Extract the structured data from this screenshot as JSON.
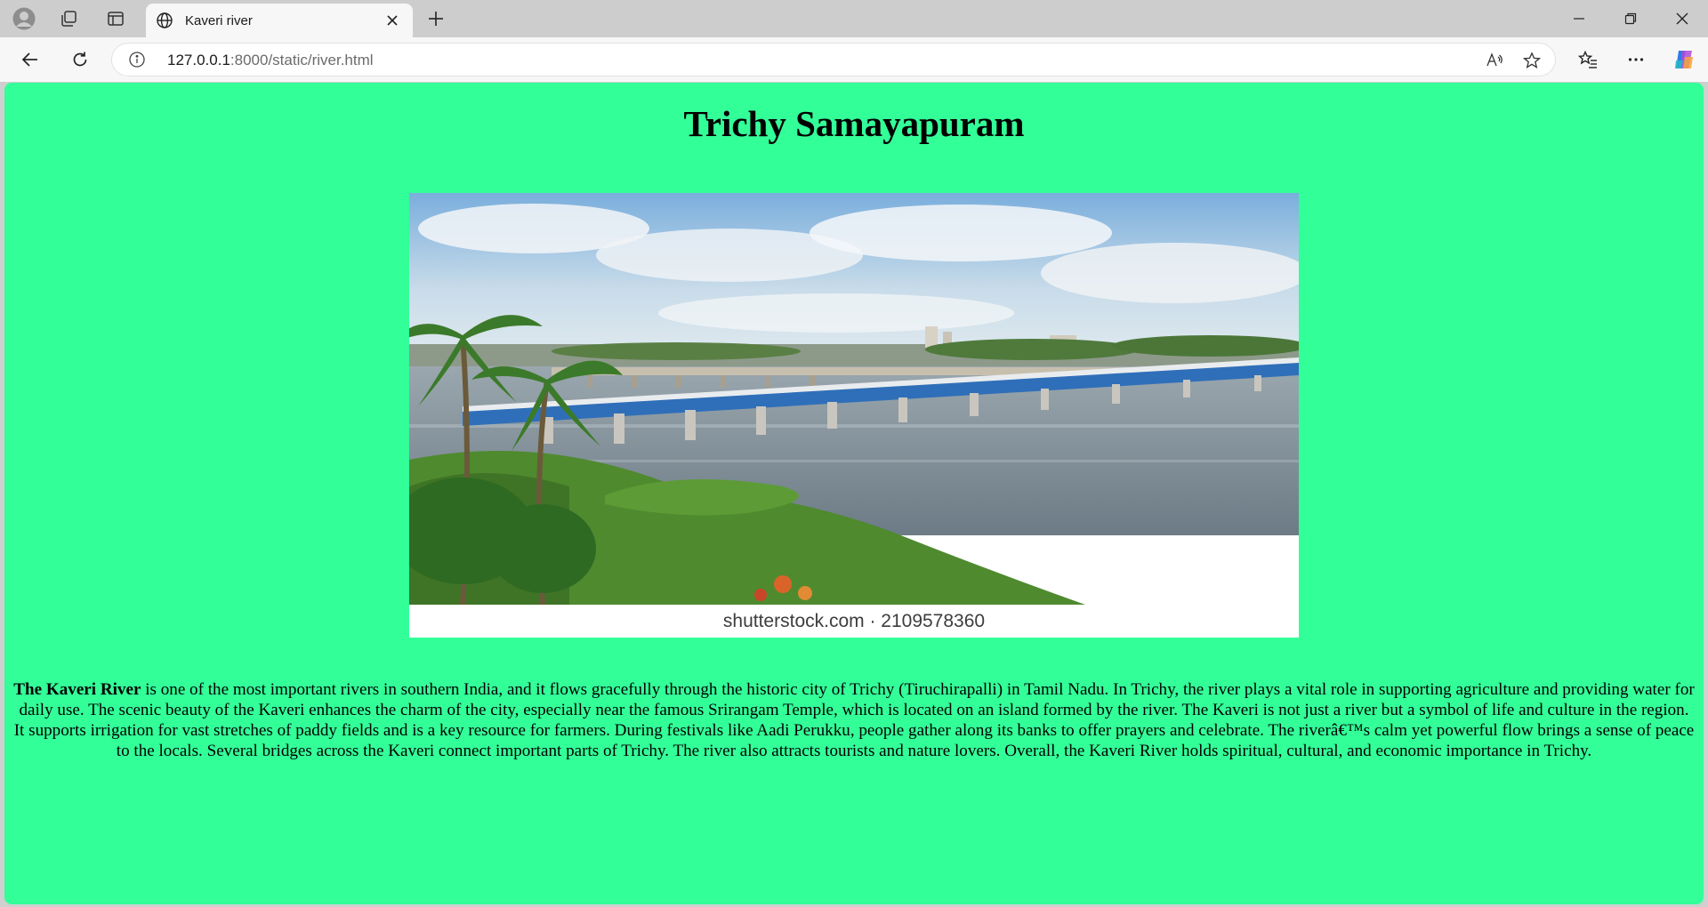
{
  "browser": {
    "tab": {
      "title": "Kaveri river"
    },
    "address": {
      "host": "127.0.0.1",
      "path": ":8000/static/river.html"
    }
  },
  "page": {
    "heading": "Trichy Samayapuram",
    "image": {
      "watermark": "shutterstock.com · 2109578360"
    },
    "paragraph": {
      "bold_lead": "The Kaveri River",
      "body": " is one of the most important rivers in southern India, and it flows gracefully through the historic city of Trichy (Tiruchirapalli) in Tamil Nadu. In Trichy, the river plays a vital role in supporting agriculture and providing water for daily use. The scenic beauty of the Kaveri enhances the charm of the city, especially near the famous Srirangam Temple, which is located on an island formed by the river. The Kaveri is not just a river but a symbol of life and culture in the region. It supports irrigation for vast stretches of paddy fields and is a key resource for farmers. During festivals like Aadi Perukku, people gather along its banks to offer prayers and celebrate. The riverâ€™s calm yet powerful flow brings a sense of peace to the locals. Several bridges across the Kaveri connect important parts of Trichy. The river also attracts tourists and nature lovers. Overall, the Kaveri River holds spiritual, cultural, and economic importance in Trichy."
    }
  },
  "colors": {
    "page_background": "#33ff99",
    "chrome": "#cdcdcd",
    "toolbar": "#f7f7f7"
  },
  "icons": {
    "profile": "profile-avatar-icon",
    "workspaces": "workspaces-icon",
    "tab_actions": "vertical-tabs-icon",
    "site": "globe-icon",
    "close_tab": "close-icon",
    "new_tab": "plus-icon",
    "minimize": "minimize-icon",
    "restore": "restore-icon",
    "close_window": "close-icon",
    "back": "back-arrow-icon",
    "refresh": "refresh-icon",
    "site_info": "info-icon",
    "read_aloud": "read-aloud-icon",
    "favorite": "star-icon",
    "favorites": "favorites-icon",
    "more": "more-icon",
    "copilot": "copilot-icon"
  }
}
